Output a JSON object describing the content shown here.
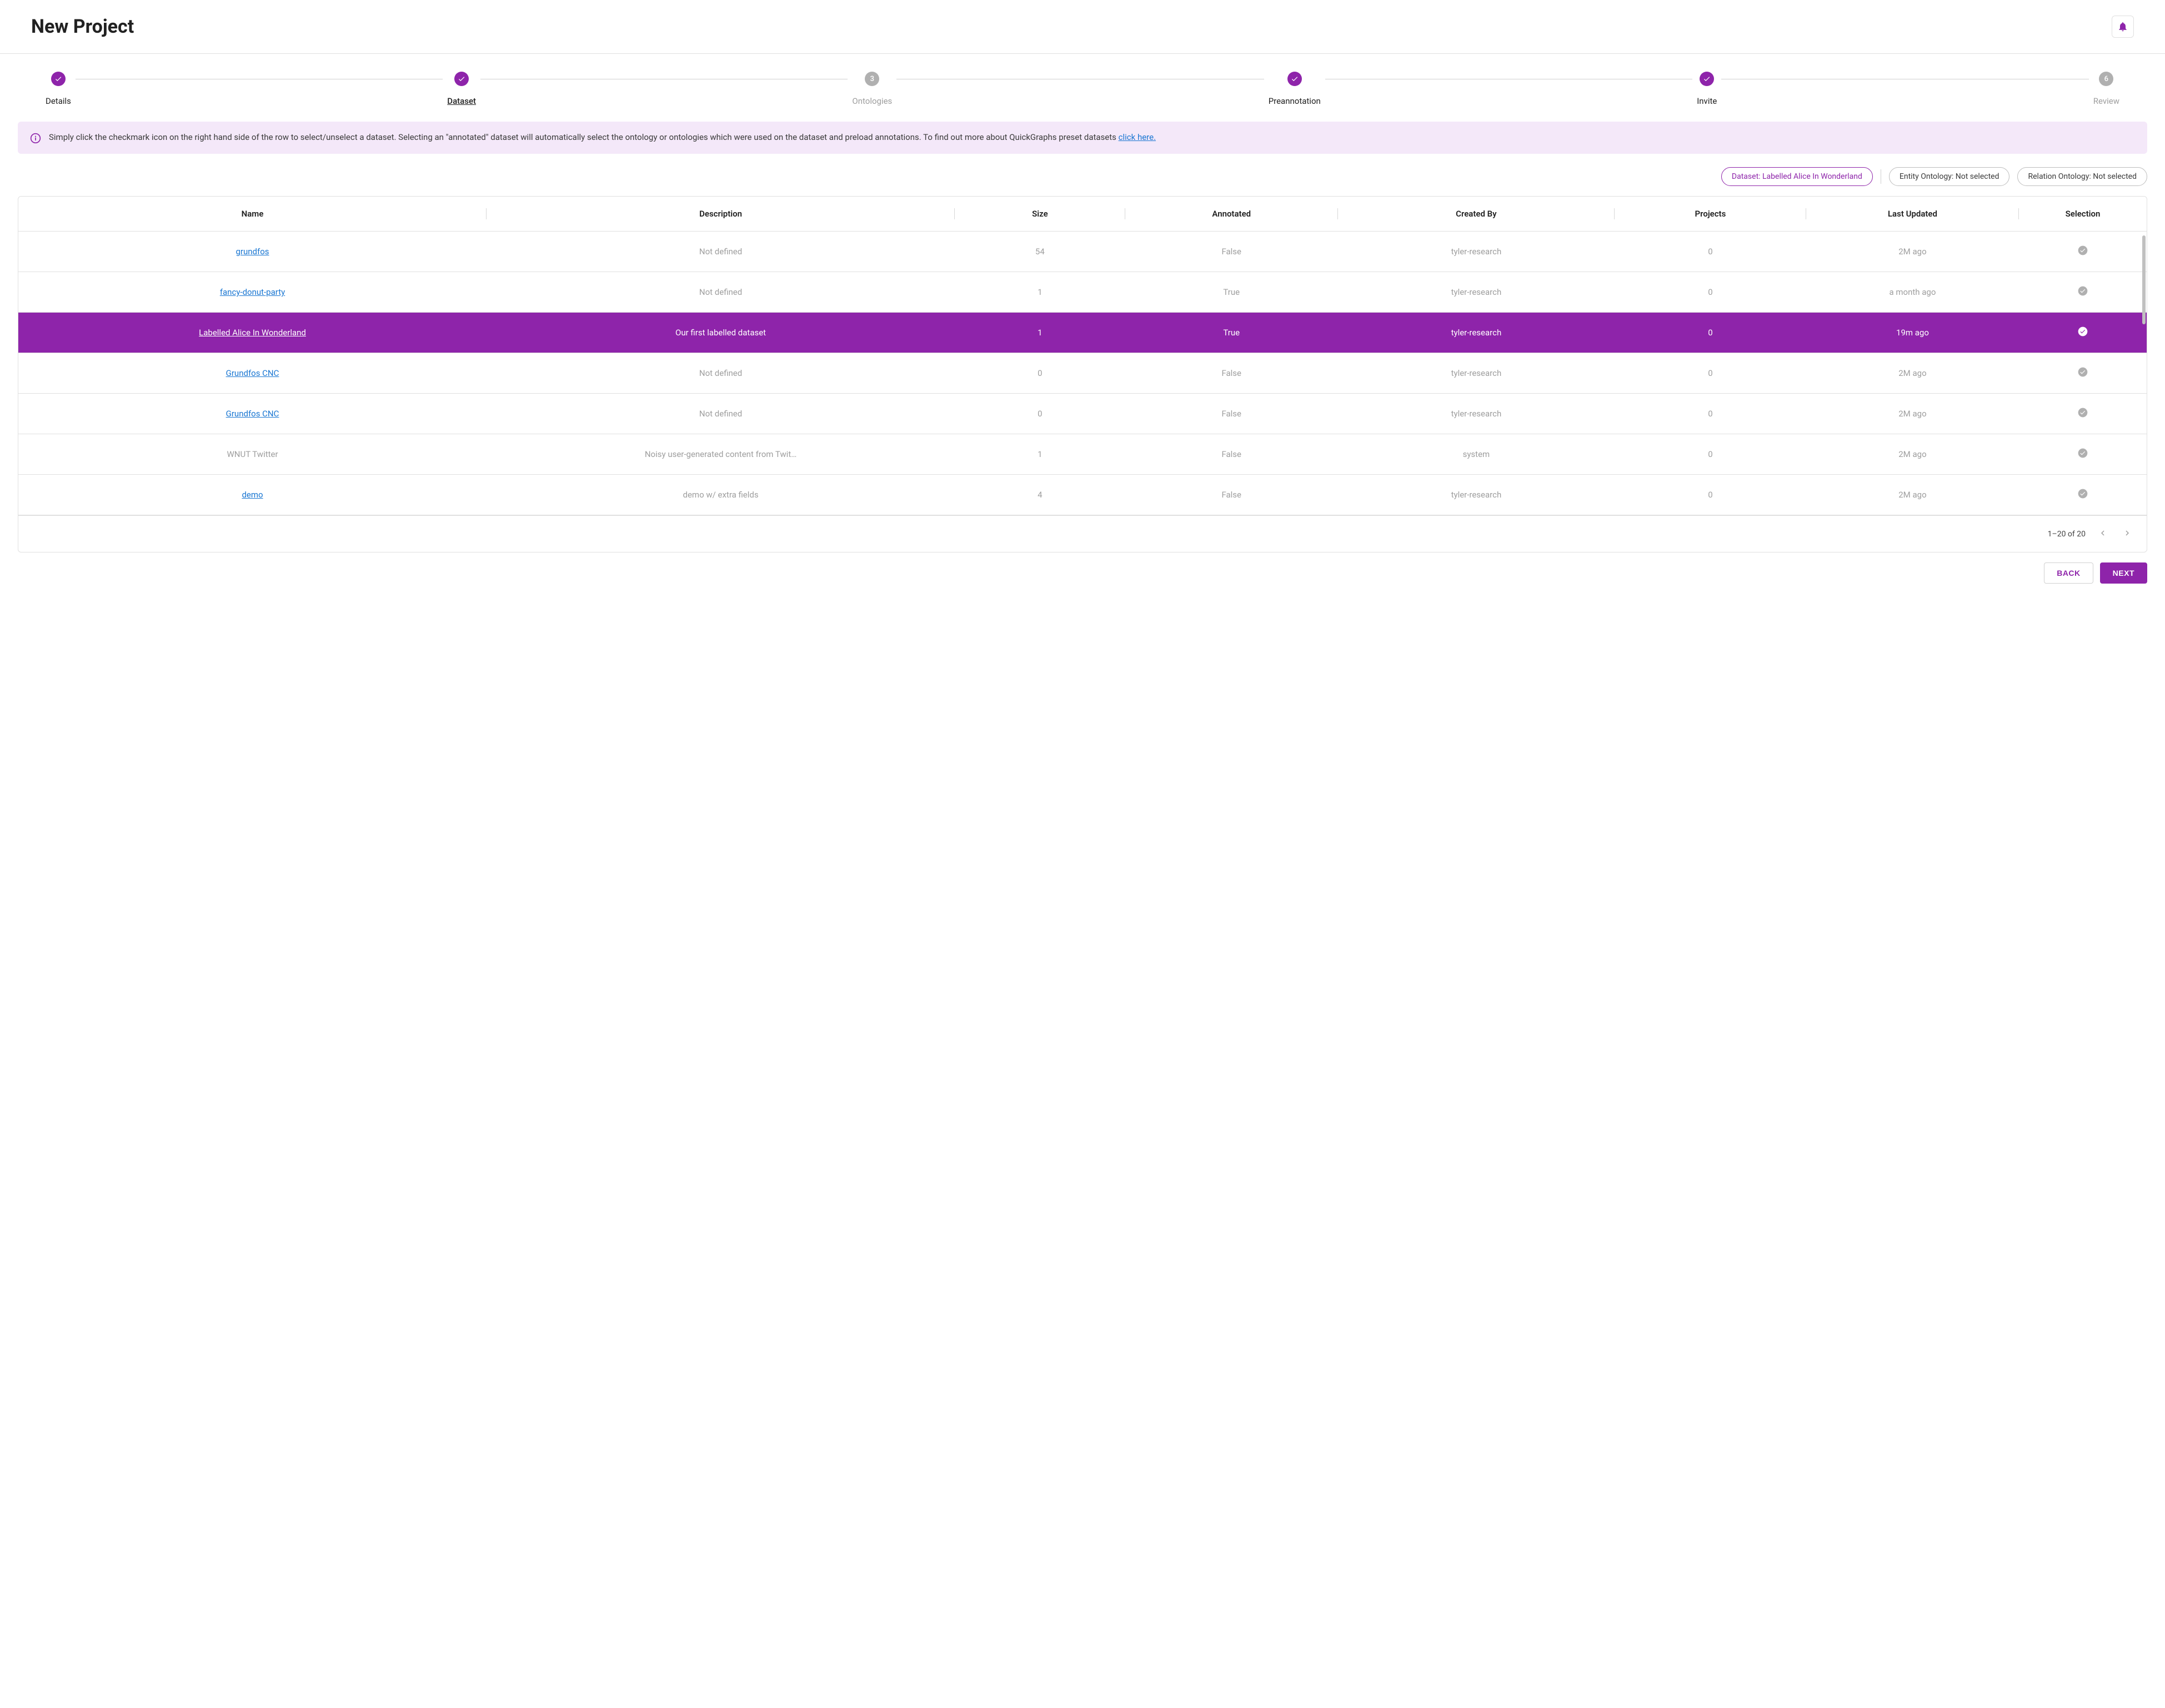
{
  "header": {
    "title": "New Project"
  },
  "stepper": [
    {
      "label": "Details",
      "state": "done"
    },
    {
      "label": "Dataset",
      "state": "done",
      "active": true
    },
    {
      "label": "Ontologies",
      "state": "pending",
      "number": "3"
    },
    {
      "label": "Preannotation",
      "state": "done"
    },
    {
      "label": "Invite",
      "state": "done"
    },
    {
      "label": "Review",
      "state": "pending",
      "number": "6"
    }
  ],
  "info": {
    "text_part1": "Simply click the checkmark icon on the right hand side of the row to select/unselect a dataset. Selecting an \"annotated\" dataset will automatically select the ontology or ontologies which were used on the dataset and preload annotations. To find out more about QuickGraphs preset datasets ",
    "link_text": "click here."
  },
  "chips": {
    "dataset": "Dataset: Labelled Alice In Wonderland",
    "entity": "Entity Ontology: Not selected",
    "relation": "Relation Ontology: Not selected"
  },
  "table": {
    "headers": [
      "Name",
      "Description",
      "Size",
      "Annotated",
      "Created By",
      "Projects",
      "Last Updated",
      "Selection"
    ],
    "rows": [
      {
        "name": "grundfos",
        "description": "Not defined",
        "size": "54",
        "annotated": "False",
        "created_by": "tyler-research",
        "projects": "0",
        "last_updated": "2M ago",
        "selected": false,
        "link": true
      },
      {
        "name": "fancy-donut-party",
        "description": "Not defined",
        "size": "1",
        "annotated": "True",
        "created_by": "tyler-research",
        "projects": "0",
        "last_updated": "a month ago",
        "selected": false,
        "link": true
      },
      {
        "name": "Labelled Alice In Wonderland",
        "description": "Our first labelled dataset",
        "size": "1",
        "annotated": "True",
        "created_by": "tyler-research",
        "projects": "0",
        "last_updated": "19m ago",
        "selected": true,
        "link": false
      },
      {
        "name": "Grundfos CNC",
        "description": "Not defined",
        "size": "0",
        "annotated": "False",
        "created_by": "tyler-research",
        "projects": "0",
        "last_updated": "2M ago",
        "selected": false,
        "link": true
      },
      {
        "name": "Grundfos CNC",
        "description": "Not defined",
        "size": "0",
        "annotated": "False",
        "created_by": "tyler-research",
        "projects": "0",
        "last_updated": "2M ago",
        "selected": false,
        "link": true
      },
      {
        "name": "WNUT Twitter",
        "description": "Noisy user-generated content from Twit…",
        "size": "1",
        "annotated": "False",
        "created_by": "system",
        "projects": "0",
        "last_updated": "2M ago",
        "selected": false,
        "link": false
      },
      {
        "name": "demo",
        "description": "demo w/ extra fields",
        "size": "4",
        "annotated": "False",
        "created_by": "tyler-research",
        "projects": "0",
        "last_updated": "2M ago",
        "selected": false,
        "link": true
      }
    ]
  },
  "pagination": {
    "range": "1–20 of 20"
  },
  "buttons": {
    "back": "BACK",
    "next": "NEXT"
  }
}
